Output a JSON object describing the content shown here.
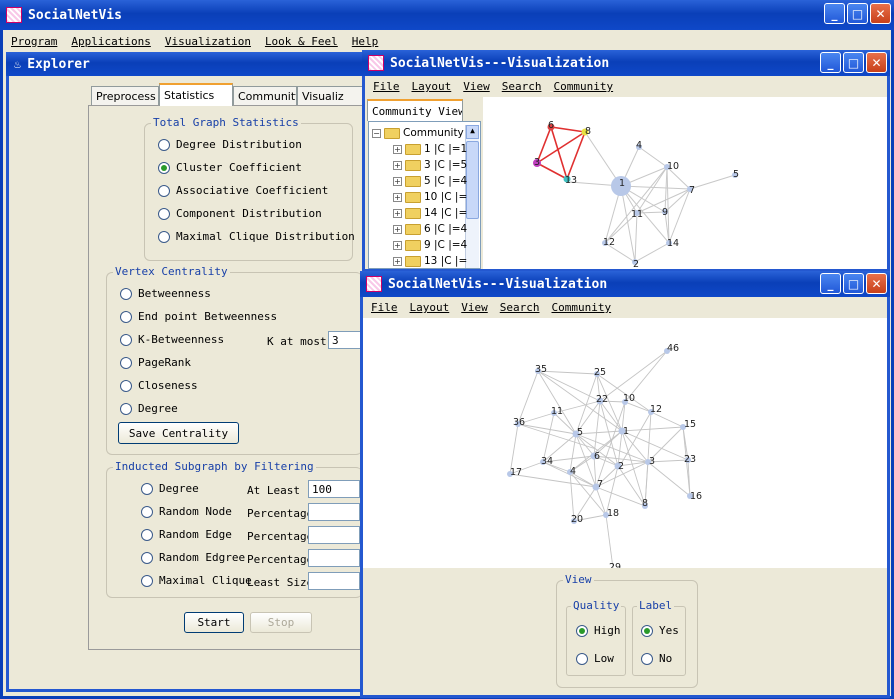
{
  "main_window": {
    "title": "SocialNetVis",
    "menu": [
      "Program",
      "Applications",
      "Visualization",
      "Look & Feel",
      "Help"
    ]
  },
  "explorer": {
    "title": "Explorer",
    "tabs": [
      "Preprocess",
      "Statistics",
      "Community",
      "Visualiz"
    ],
    "active_tab": "Statistics",
    "total_graph_stats": {
      "label": "Total Graph Statistics",
      "options": [
        "Degree Distribution",
        "Cluster Coefficient",
        "Associative Coefficient",
        "Component Distribution",
        "Maximal Clique Distribution"
      ],
      "selected": "Cluster Coefficient"
    },
    "vertex_centrality": {
      "label": "Vertex Centrality",
      "options": [
        "Betweenness",
        "End point Betweenness",
        "K-Betweenness",
        "PageRank",
        "Closeness",
        "Degree"
      ],
      "k_label": "K at most",
      "k_value": "3",
      "save_button": "Save Centrality"
    },
    "subgraph": {
      "label": "Inducted Subgraph by Filtering",
      "rows": [
        {
          "option": "Degree",
          "param": "At Least",
          "value": "100"
        },
        {
          "option": "Random Node",
          "param": "Percentage",
          "value": ""
        },
        {
          "option": "Random Edge",
          "param": "Percentage",
          "value": ""
        },
        {
          "option": "Random Edgree",
          "param": "Percentage",
          "value": ""
        },
        {
          "option": "Maximal Clique",
          "param": "Least Size",
          "value": ""
        }
      ]
    },
    "start_button": "Start",
    "stop_button": "Stop"
  },
  "vis_window_1": {
    "title": "SocialNetVis---Visualization",
    "menu": [
      "File",
      "Layout",
      "View",
      "Search",
      "Community"
    ],
    "tab": "Community View",
    "tree_root": "Community",
    "tree_items": [
      "1 |C |=1",
      "3 |C |=5",
      "5 |C |=4",
      "10 |C |=",
      "14 |C |=",
      "6 |C |=4",
      "9 |C |=4",
      "13 |C |="
    ],
    "graph_labels": [
      "6",
      "8",
      "3",
      "13",
      "4",
      "10",
      "7",
      "5",
      "1",
      "11",
      "9",
      "12",
      "14",
      "2"
    ]
  },
  "vis_window_2": {
    "title": "SocialNetVis---Visualization",
    "menu": [
      "File",
      "Layout",
      "View",
      "Search",
      "Community"
    ],
    "graph_labels": [
      "46",
      "35",
      "25",
      "22",
      "10",
      "12",
      "11",
      "36",
      "5",
      "1",
      "15",
      "34",
      "6",
      "2",
      "3",
      "23",
      "17",
      "4",
      "7",
      "8",
      "16",
      "20",
      "18",
      "29"
    ],
    "view_panel": {
      "label": "View",
      "quality_label": "Quality",
      "quality_options": [
        "High",
        "Low"
      ],
      "quality_selected": "High",
      "label_label": "Label",
      "label_options": [
        "Yes",
        "No"
      ],
      "label_selected": "Yes"
    }
  },
  "colors": {
    "titlebar": "#0a3fb8",
    "group_label": "#1840a8",
    "clique_edge": "#e03030",
    "node": "#b8c8e8"
  }
}
